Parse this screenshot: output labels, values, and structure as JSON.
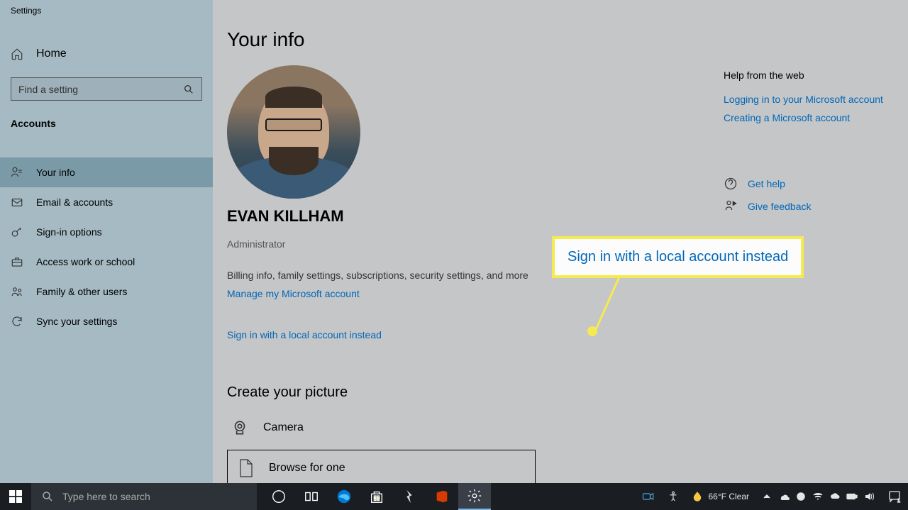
{
  "window": {
    "title": "Settings"
  },
  "sidebar": {
    "home": "Home",
    "search_placeholder": "Find a setting",
    "section": "Accounts",
    "items": [
      {
        "label": "Your info"
      },
      {
        "label": "Email & accounts"
      },
      {
        "label": "Sign-in options"
      },
      {
        "label": "Access work or school"
      },
      {
        "label": "Family & other users"
      },
      {
        "label": "Sync your settings"
      }
    ]
  },
  "main": {
    "title": "Your info",
    "user_name": "EVAN KILLHAM",
    "user_role": "Administrator",
    "billing_text": "Billing info, family settings, subscriptions, security settings, and more",
    "manage_link": "Manage my Microsoft account",
    "signin_link": "Sign in with a local account instead",
    "callout_text": "Sign in with a local account instead",
    "create_picture": "Create your picture",
    "camera": "Camera",
    "browse": "Browse for one"
  },
  "help": {
    "title": "Help from the web",
    "links": [
      "Logging in to your Microsoft account",
      "Creating a Microsoft account"
    ],
    "get_help": "Get help",
    "give_feedback": "Give feedback"
  },
  "taskbar": {
    "search_placeholder": "Type here to search",
    "weather_temp": "66°F",
    "weather_cond": "Clear"
  }
}
